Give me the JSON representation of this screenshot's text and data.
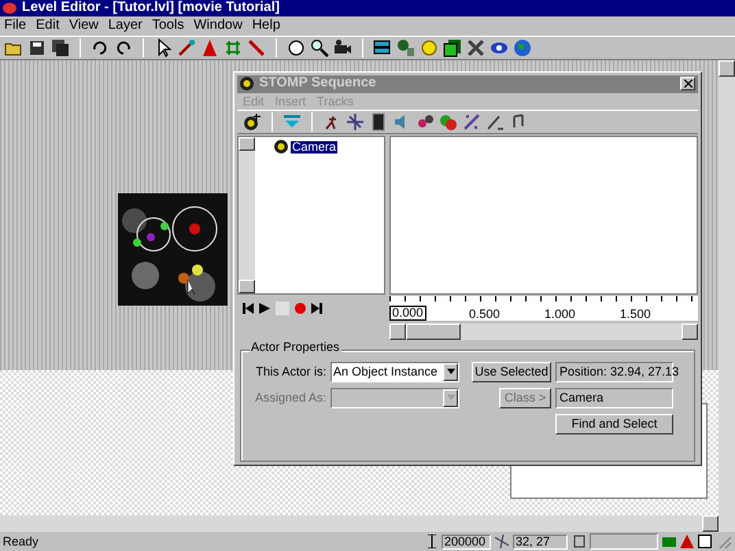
{
  "window": {
    "title": "Level Editor - [Tutor.lvl]  [movie Tutorial]"
  },
  "menu": [
    "File",
    "Edit",
    "View",
    "Layer",
    "Tools",
    "Window",
    "Help"
  ],
  "sequence_window": {
    "title": "STOMP Sequence",
    "menu": [
      {
        "label": "Edit",
        "disabled": true
      },
      {
        "label": "Insert",
        "disabled": true
      },
      {
        "label": "Tracks",
        "disabled": true
      }
    ],
    "tree": [
      {
        "label": "Camera",
        "selected": true
      }
    ],
    "ruler": [
      "0.000",
      "0.500",
      "1.000",
      "1.500"
    ],
    "actor_properties": {
      "title": "Actor Properties",
      "actor_label": "This Actor is:",
      "actor_value": "An Object Instance",
      "use_selected": "Use Selected",
      "position": "Position: 32.94, 27.13",
      "assigned_label": "Assigned As:",
      "assigned_disabled": true,
      "class_button": "Class >",
      "class_disabled": true,
      "name": "Camera",
      "find": "Find and Select"
    }
  },
  "status_bar": {
    "text": "Ready",
    "value": "200000",
    "coords": "32, 27"
  }
}
